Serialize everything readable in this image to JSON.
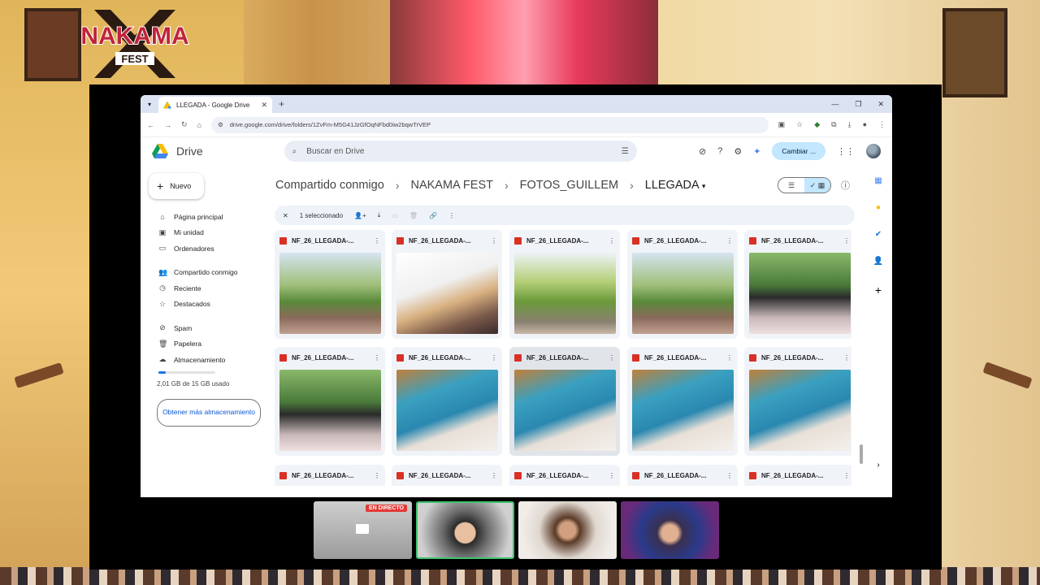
{
  "overlay": {
    "logo_line1": "NAKAMA",
    "logo_line2": "FEST",
    "colors": {
      "logo_red": "#c0243a",
      "logo_dark": "#2a1a12"
    }
  },
  "browser": {
    "tab_title": "LLEGADA - Google Drive",
    "url": "drive.google.com/drive/folders/1ZvFm-M5G41JzGfOqNFbd0iw2bqwTrVEP"
  },
  "drive": {
    "app_name": "Drive",
    "search_placeholder": "Buscar en Drive",
    "switch_label": "Cambiar ...",
    "new_label": "Nuevo",
    "nav": {
      "group1": [
        {
          "label": "Página principal",
          "icon": "home-icon"
        },
        {
          "label": "Mi unidad",
          "icon": "my-drive-icon"
        },
        {
          "label": "Ordenadores",
          "icon": "computer-icon"
        }
      ],
      "group2": [
        {
          "label": "Compartido conmigo",
          "icon": "shared-icon"
        },
        {
          "label": "Reciente",
          "icon": "clock-icon"
        },
        {
          "label": "Destacados",
          "icon": "star-icon"
        }
      ],
      "group3": [
        {
          "label": "Spam",
          "icon": "spam-icon"
        },
        {
          "label": "Papelera",
          "icon": "trash-icon"
        },
        {
          "label": "Almacenamiento",
          "icon": "cloud-icon"
        }
      ]
    },
    "storage_used": 0.13,
    "storage_text": "2,01 GB de 15 GB usado",
    "more_storage": "Obtener más almacenamiento",
    "breadcrumb": [
      "Compartido conmigo",
      "NAKAMA FEST",
      "FOTOS_GUILLEM",
      "LLEGADA"
    ],
    "selection_text": "1 seleccionado",
    "file_name": "NF_26_LLEGADA-...",
    "files_row1": [
      "NF_26_LLEGADA-...",
      "NF_26_LLEGADA-...",
      "NF_26_LLEGADA-...",
      "NF_26_LLEGADA-...",
      "NF_26_LLEGADA-..."
    ],
    "files_row2": [
      "NF_26_LLEGADA-...",
      "NF_26_LLEGADA-...",
      "NF_26_LLEGADA-...",
      "NF_26_LLEGADA-...",
      "NF_26_LLEGADA-..."
    ],
    "files_row3": [
      "NF_26_LLEGADA-...",
      "NF_26_LLEGADA-...",
      "NF_26_LLEGADA-...",
      "NF_26_LLEGADA-...",
      "NF_26_LLEGADA-..."
    ]
  },
  "stream": {
    "live_badge": "EN DIRECTO"
  }
}
